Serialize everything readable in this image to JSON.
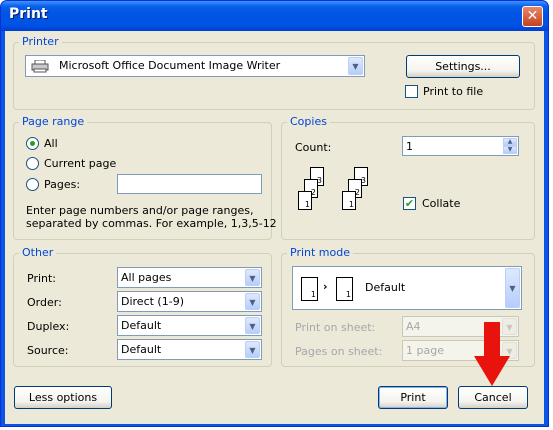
{
  "window": {
    "title": "Print",
    "close_glyph": "✕"
  },
  "printer": {
    "group_title": "Printer",
    "selected": "Microsoft Office Document Image Writer",
    "settings_label": "Settings...",
    "print_to_file_label": "Print to file",
    "print_to_file_checked": false
  },
  "page_range": {
    "group_title": "Page range",
    "options": [
      "All",
      "Current page",
      "Pages:"
    ],
    "selected": "All",
    "pages_value": "",
    "help_line1": "Enter page numbers and/or page ranges,",
    "help_line2": "separated by commas. For example, 1,3,5-12"
  },
  "copies": {
    "group_title": "Copies",
    "count_label": "Count:",
    "count_value": "1",
    "collate_label": "Collate",
    "collate_checked": true,
    "page_numbers": [
      "1",
      "2",
      "3"
    ]
  },
  "other": {
    "group_title": "Other",
    "print_label": "Print:",
    "print_value": "All pages",
    "order_label": "Order:",
    "order_value": "Direct (1-9)",
    "duplex_label": "Duplex:",
    "duplex_value": "Default",
    "source_label": "Source:",
    "source_value": "Default"
  },
  "print_mode": {
    "group_title": "Print mode",
    "mode_value": "Default",
    "preview_pages": [
      "1",
      "1"
    ],
    "sheet_label": "Print on sheet:",
    "sheet_value": "A4",
    "pages_on_sheet_label": "Pages on sheet:",
    "pages_on_sheet_value": "1 page"
  },
  "buttons": {
    "less_options": "Less options",
    "print": "Print",
    "cancel": "Cancel"
  },
  "colors": {
    "title_bar": "#0054e3",
    "group_title": "#0046d5",
    "annotation_arrow": "#e8130c"
  }
}
